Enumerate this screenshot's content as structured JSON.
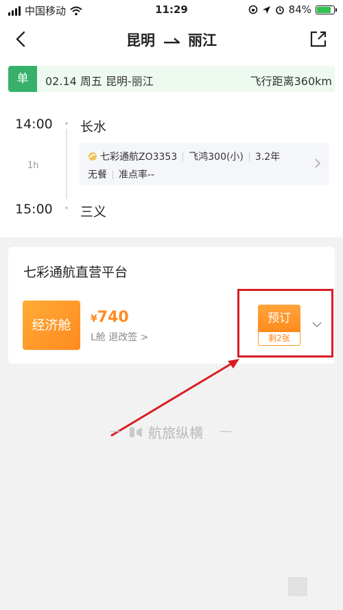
{
  "status_bar": {
    "carrier": "中国移动",
    "time": "11:29",
    "battery_pct": "84%",
    "battery_level": 0.84
  },
  "header": {
    "from_city": "昆明",
    "to_city": "丽江"
  },
  "trip": {
    "type_tag": "单",
    "date_route": "02.14 周五 昆明-丽江",
    "distance": "飞行距离360km",
    "dep_time": "14:00",
    "dep_airport": "长水",
    "duration": "1h",
    "arr_time": "15:00",
    "arr_airport": "三义",
    "airline_flight": "七彩通航ZO3353",
    "aircraft": "飞鸿300(小)",
    "age": "3.2年",
    "meal": "无餐",
    "on_time": "准点率--"
  },
  "offer": {
    "platform": "七彩通航直营平台",
    "cabin": "经济舱",
    "currency": "¥",
    "price": "740",
    "rule": "L舱 退改签 >",
    "book_label": "预订",
    "remaining": "剩2张"
  },
  "watermark": {
    "text": "航旅纵横"
  },
  "colors": {
    "accent": "#ff8b1f",
    "green_tag": "#36b06a",
    "highlight": "#d91c23"
  }
}
